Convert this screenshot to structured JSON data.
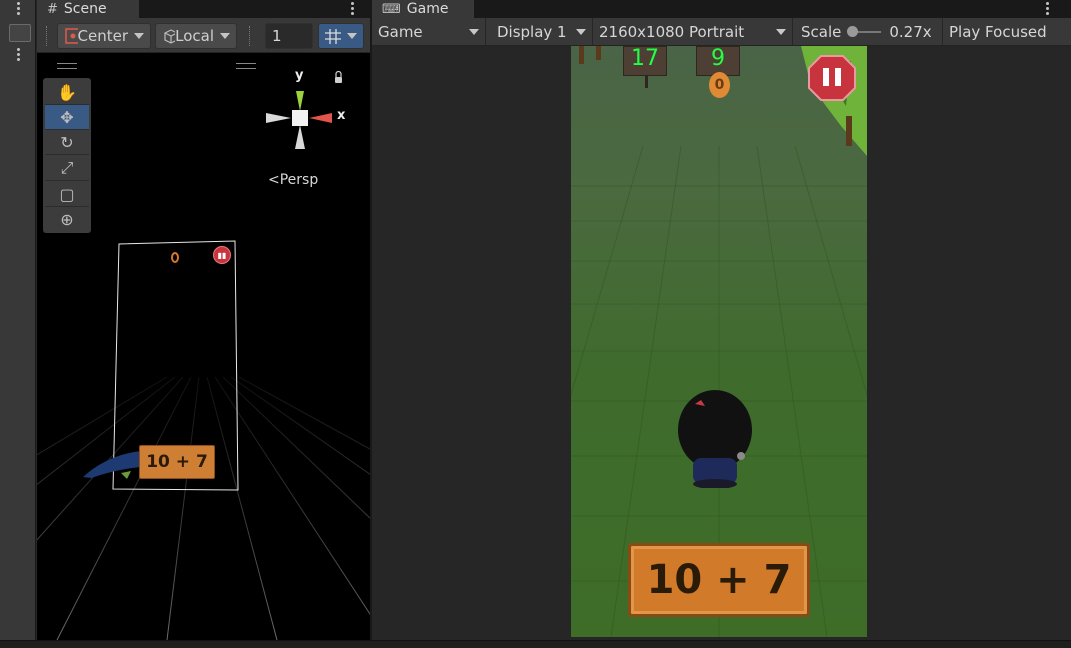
{
  "scene_tab": {
    "label": "Scene",
    "icon": "grid-icon"
  },
  "game_tab": {
    "label": "Game",
    "icon": "gamepad-icon"
  },
  "scene_toolbar": {
    "pivot_label": "Center",
    "space_label": "Local",
    "grid_value": "1"
  },
  "gizmo": {
    "y_label": "y",
    "x_label": "x",
    "projection_label": "Persp"
  },
  "scene_tools": [
    "hand-tool",
    "move-tool",
    "rotate-tool",
    "scale-tool",
    "rect-tool",
    "transform-tool"
  ],
  "scene_preview": {
    "equation": "10 + 7",
    "score": "0"
  },
  "game_toolbar": {
    "mode_label": "Game",
    "display_label": "Display 1",
    "resolution_label": "2160x1080 Portrait",
    "scale_label": "Scale",
    "scale_value": "0.27x",
    "play_focused_label": "Play Focused"
  },
  "game_view": {
    "score_left": "17",
    "score_right": "9",
    "coin_label": "0",
    "equation": "10 + 7"
  },
  "colors": {
    "accent_selected": "#3a5a86",
    "score_text": "#22ff44",
    "pause_button": "#c8343d",
    "sign_wood": "#d07a2a"
  }
}
